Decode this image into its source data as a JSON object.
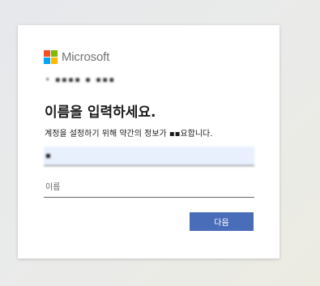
{
  "brand": {
    "name": "Microsoft",
    "logo_colors": [
      "#f25022",
      "#7fba00",
      "#00a4ef",
      "#ffb900"
    ]
  },
  "identity": {
    "text": "• ▪▪▪▪ ▪ ▪▪▪"
  },
  "page": {
    "title": "이름을 입력하세요.",
    "description": "계정을 설정하기 위해 약간의 정보가 ▪▪요합니다."
  },
  "form": {
    "last_name": {
      "value": "▪"
    },
    "first_name": {
      "placeholder": "이름",
      "value": ""
    }
  },
  "actions": {
    "next_label": "다음"
  },
  "colors": {
    "primary_button": "#4a6db9",
    "autofill_bg": "#e8f0fe"
  }
}
